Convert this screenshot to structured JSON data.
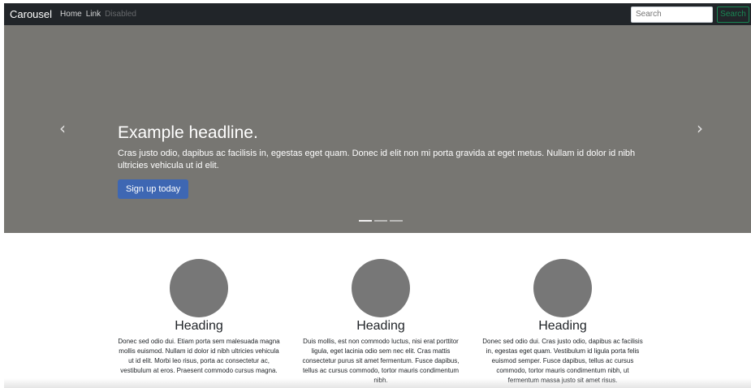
{
  "navbar": {
    "brand": "Carousel",
    "links": [
      "Home",
      "Link",
      "Disabled"
    ],
    "search_placeholder": "Search",
    "search_button": "Search"
  },
  "carousel": {
    "headline": "Example headline.",
    "text": "Cras justo odio, dapibus ac facilisis in, egestas eget quam. Donec id elit non mi porta gravida at eget metus. Nullam id dolor id nibh ultricies vehicula ut id elit.",
    "button": "Sign up today",
    "prev_icon": "chevron-left-icon",
    "next_icon": "chevron-right-icon",
    "slide_count": 3,
    "active_slide": 1
  },
  "marketing": [
    {
      "heading": "Heading",
      "text": "Donec sed odio dui. Etiam porta sem malesuada magna mollis euismod. Nullam id dolor id nibh ultricies vehicula ut id elit. Morbi leo risus, porta ac consectetur ac, vestibulum at eros. Praesent commodo cursus magna."
    },
    {
      "heading": "Heading",
      "text": "Duis mollis, est non commodo luctus, nisi erat porttitor ligula, eget lacinia odio sem nec elit. Cras mattis consectetur purus sit amet fermentum. Fusce dapibus, tellus ac cursus commodo, tortor mauris condimentum nibh."
    },
    {
      "heading": "Heading",
      "text": "Donec sed odio dui. Cras justo odio, dapibus ac facilisis in, egestas eget quam. Vestibulum id ligula porta felis euismod semper. Fusce dapibus, tellus ac cursus commodo, tortor mauris condimentum nibh, ut fermentum massa justo sit amet risus."
    }
  ],
  "colors": {
    "navbar_bg": "#212529",
    "carousel_bg": "#777672",
    "primary": "#3e67b3",
    "success": "#198754",
    "placeholder_circle": "#777777"
  }
}
